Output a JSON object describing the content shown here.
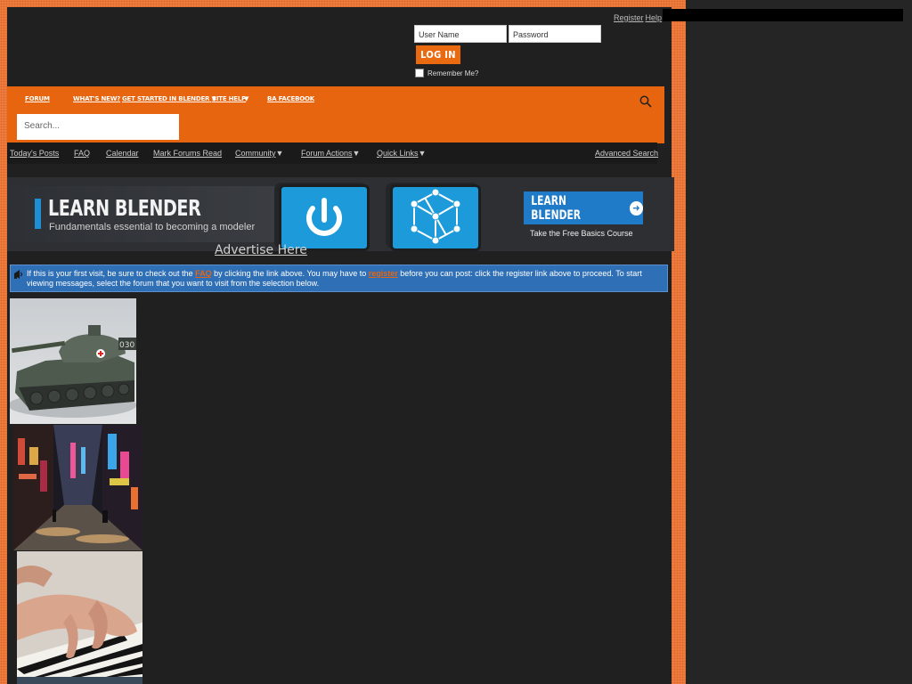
{
  "header": {
    "register_link": "Register",
    "help_link": "Help",
    "username_placeholder": "User Name",
    "password_placeholder": "Password",
    "login_button": "LOG IN",
    "remember_me": "Remember Me?"
  },
  "nav": {
    "items": [
      "FORUM",
      "WHAT'S NEW?",
      "GET STARTED IN BLENDER",
      "SITE HELP",
      "BA FACEBOOK"
    ],
    "dropdown_arrow": "▼",
    "search_placeholder": "Search..."
  },
  "subnav": {
    "items": [
      "Today's Posts",
      "FAQ",
      "Calendar",
      "Mark Forums Read",
      "Community",
      "Forum Actions",
      "Quick Links"
    ],
    "advanced_search": "Advanced Search",
    "arrow": "▼"
  },
  "banner": {
    "title": "LEARN BLENDER",
    "subtitle": "Fundamentals essential to becoming a modeler",
    "cta_label": "LEARN BLENDER",
    "cta_sub": "Take the Free Basics Course",
    "advertise": "Advertise Here"
  },
  "notice": {
    "part1": "If this is your first visit, be sure to check out the ",
    "faq": "FAQ",
    "part2": " by clicking the link above. You may have to ",
    "register": "register",
    "part3": " before you can post: click the register link above to proceed. To start viewing messages, select the forum that you want to visit from the selection below."
  },
  "colors": {
    "accent_orange": "#e8650f",
    "notice_blue": "#2f6fb5",
    "cta_blue": "#1f7ac8"
  },
  "tank_marking": "030"
}
